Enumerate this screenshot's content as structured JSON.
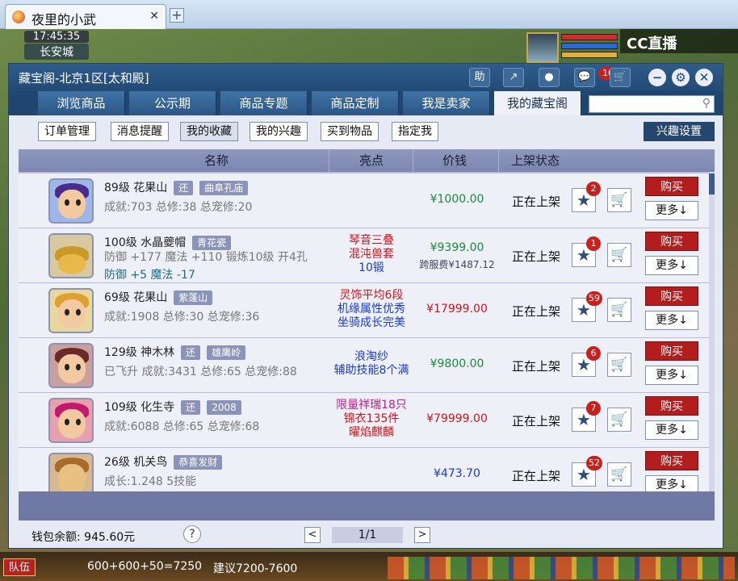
{
  "browser": {
    "tab_title": "夜里的小武",
    "close": "✕",
    "new_tab": "+"
  },
  "game": {
    "time": "17:45:35",
    "location": "长安城",
    "stream_logo": "CC直播"
  },
  "window": {
    "title": "藏宝阁-北京1区[太和殿]",
    "toolbar": {
      "help": "助",
      "share": "↗",
      "record": "●",
      "chat": "💬",
      "chat_badge": "10",
      "cart": "🛒"
    },
    "controls": {
      "minimize": "−",
      "settings": "⚙",
      "close": "✕"
    }
  },
  "nav": {
    "tabs": [
      "浏览商品",
      "公示期",
      "商品专题",
      "商品定制",
      "我是卖家",
      "我的藏宝阁"
    ],
    "active": 5,
    "search_placeholder": ""
  },
  "subnav": {
    "buttons": [
      "订单管理",
      "消息提醒",
      "我的收藏",
      "我的兴趣",
      "买到物品",
      "指定我"
    ],
    "active": 2,
    "interest_settings": "兴趣设置"
  },
  "table": {
    "headers": {
      "name": "名称",
      "highlight": "亮点",
      "price": "价钱",
      "status": "上架状态"
    },
    "rows": [
      {
        "level_name": "89级 花果山",
        "tag1": "还",
        "tag2": "曲阜孔庙",
        "details": "成就:703 总修:38 总宠修:20",
        "details2": "",
        "highlights": [
          "",
          "",
          ""
        ],
        "price": "¥1000.00",
        "price_color": "#1a8a3a",
        "sub_price": "",
        "status": "正在上架",
        "fav_count": "2",
        "buy": "购买",
        "more": "更多↓"
      },
      {
        "level_name": "100级 水晶夔帽",
        "tag1": "",
        "tag2": "青花瓷",
        "details": "防御 +177 魔法 +110 锻炼10级 开4孔",
        "details2": "防御 +5 魔法 -17",
        "highlights": [
          "琴音三叠",
          "混沌兽套",
          "10锻"
        ],
        "price": "¥9399.00",
        "price_color": "#1a8a3a",
        "sub_price": "跨服费¥1487.12",
        "status": "正在上架",
        "fav_count": "1",
        "buy": "购买",
        "more": "更多↓"
      },
      {
        "level_name": "69级 花果山",
        "tag1": "",
        "tag2": "紫蓬山",
        "details": "成就:1908 总修:30 总宠修:36",
        "details2": "",
        "highlights": [
          "灵饰平均6段",
          "机缘属性优秀",
          "坐骑成长完美"
        ],
        "price": "¥17999.00",
        "price_color": "#d4121a",
        "sub_price": "",
        "status": "正在上架",
        "fav_count": "59",
        "buy": "购买",
        "more": "更多↓"
      },
      {
        "level_name": "129级 神木林",
        "tag1": "还",
        "tag2": "雄鹰岭",
        "details": "已飞升 成就:3431 总修:65 总宠修:88",
        "details2": "",
        "highlights": [
          "浪淘纱",
          "辅助技能8个满",
          ""
        ],
        "price": "¥9800.00",
        "price_color": "#1a8a3a",
        "sub_price": "",
        "status": "正在上架",
        "fav_count": "6",
        "buy": "购买",
        "more": "更多↓"
      },
      {
        "level_name": "109级 化生寺",
        "tag1": "还",
        "tag2": "2008",
        "details": "成就:6088 总修:65 总宠修:68",
        "details2": "",
        "highlights": [
          "限量祥瑞18只",
          "锦衣135件",
          "曜焰麒麟"
        ],
        "price": "¥79999.00",
        "price_color": "#d4121a",
        "sub_price": "",
        "status": "正在上架",
        "fav_count": "7",
        "buy": "购买",
        "more": "更多↓"
      },
      {
        "level_name": "26级 机关鸟",
        "tag1": "",
        "tag2": "恭喜发财",
        "details": "成长:1.248 5技能",
        "details2": "",
        "highlights": [
          "",
          "",
          ""
        ],
        "price": "¥473.70",
        "price_color": "#1a3ad4",
        "sub_price": "",
        "status": "正在上架",
        "fav_count": "52",
        "buy": "购买",
        "more": "更多↓"
      }
    ],
    "highlight_colors": [
      [
        "#d4121a",
        "#d4121a",
        "#1a3ad4"
      ],
      [
        "#d4121a",
        "#1a3ad4",
        "#1a3ad4"
      ],
      [
        "#1a3ad4",
        "#1a3ad4",
        "#1a3ad4"
      ],
      [
        "#c21a8a",
        "#d4121a",
        "#d4121a"
      ]
    ]
  },
  "footer": {
    "wallet": "钱包余额: 945.60元",
    "help": "?",
    "prev": "<",
    "page": "1/1",
    "next": ">"
  },
  "hud": {
    "team": "队伍",
    "chat_text": "600+600+50=7250",
    "tip": "建议7200-7600"
  }
}
